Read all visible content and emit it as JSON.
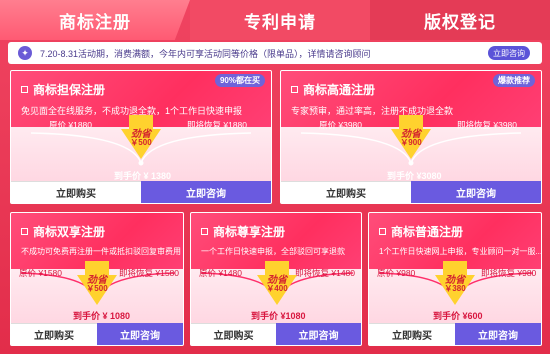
{
  "tabs": [
    {
      "label": "商标注册"
    },
    {
      "label": "专利申请"
    },
    {
      "label": "版权登记"
    }
  ],
  "notice": {
    "text": "7.20-8.31活动期，消费满额，今年内可享活动同等价格（限单品），详情请咨询顾问",
    "button": "立即咨询"
  },
  "cards": [
    {
      "title": "商标担保注册",
      "badge": "90%都在买",
      "badge_color": "#6f63d9",
      "sub": "免见面全在线服务，不成功退全款，1个工作日快速申报",
      "orig": "原价 ¥1880",
      "restore": "即将恢复 ¥1880",
      "drop_label": "劲省",
      "drop_value": "￥500",
      "final": "到手价 ¥ 1380",
      "buy": "立即购买",
      "ask": "立即咨询"
    },
    {
      "title": "商标高通注册",
      "badge": "爆款推荐",
      "badge_color": "#6f63d9",
      "sub": "专家预审，通过率高，注册不成功退全款",
      "orig": "原价 ¥3980",
      "restore": "即将恢复 ¥3980",
      "drop_label": "劲省",
      "drop_value": "￥900",
      "final": "到手价 ¥3080",
      "buy": "立即购买",
      "ask": "立即咨询"
    },
    {
      "title": "商标双享注册",
      "sub": "不成功可免费再注册一件或抵扣驳回复审费用",
      "orig": "原价 ¥1580",
      "restore": "即将恢复 ¥1580",
      "drop_label": "劲省",
      "drop_value": "￥500",
      "final": "到手价 ¥ 1080",
      "buy": "立即购买",
      "ask": "立即咨询"
    },
    {
      "title": "商标尊享注册",
      "sub": "一个工作日快速申报，全部驳回可享退款",
      "orig": "原价 ¥1480",
      "restore": "即将恢复 ¥1480",
      "drop_label": "劲省",
      "drop_value": "￥400",
      "final": "到手价 ¥1080",
      "buy": "立即购买",
      "ask": "立即咨询"
    },
    {
      "title": "商标普通注册",
      "sub": "1个工作日快速网上申报，专业顾问一对一服...",
      "orig": "原价 ¥980",
      "restore": "即将恢复 ¥980",
      "drop_label": "劲省",
      "drop_value": "￥380",
      "final": "到手价 ¥600",
      "buy": "立即购买",
      "ask": "立即咨询"
    }
  ]
}
